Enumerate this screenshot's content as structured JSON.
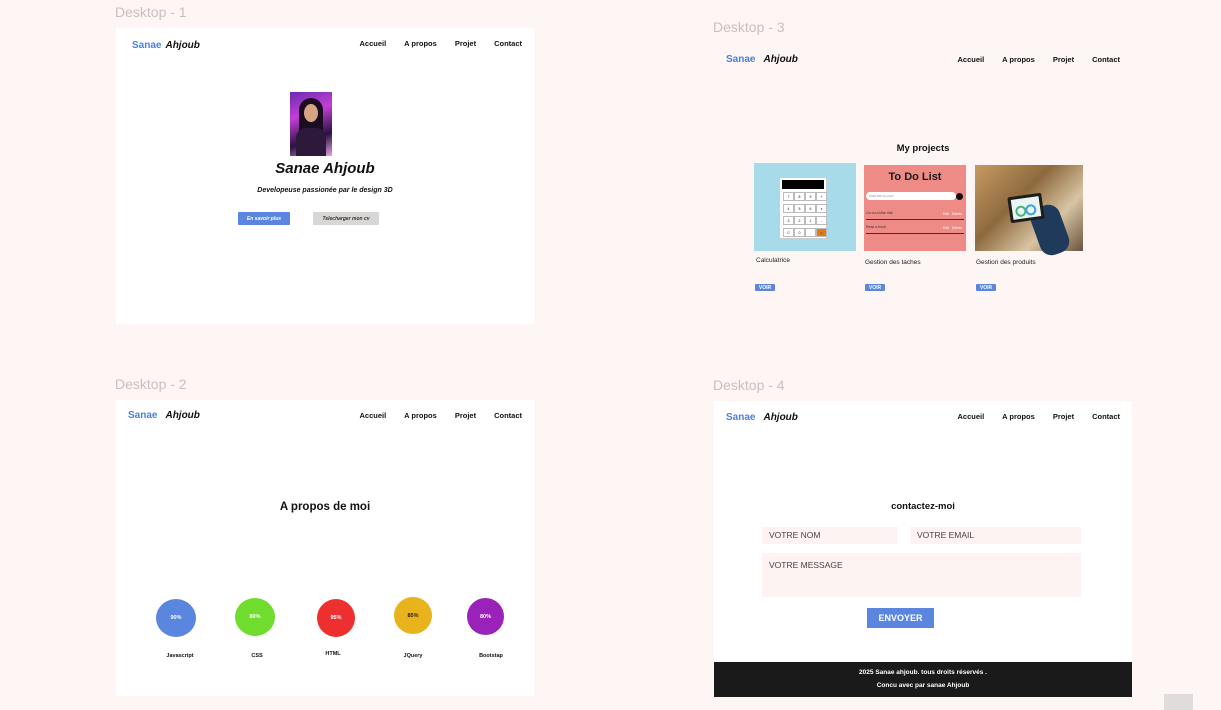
{
  "frames": {
    "f1": "Desktop - 1",
    "f2": "Desktop - 2",
    "f3": "Desktop - 3",
    "f4": "Desktop - 4"
  },
  "brand": {
    "first": "Sanae",
    "last": "Ahjoub"
  },
  "nav": [
    "Accueil",
    "A propos",
    "Projet",
    "Contact"
  ],
  "home": {
    "name": "Sanae Ahjoub",
    "tagline": "Developeuse passionée par le design 3D",
    "btn_more": "En savoir plus",
    "btn_cv": "Telecharger mon cv"
  },
  "projects": {
    "title": "My projects",
    "items": [
      {
        "caption": "Calculatrice",
        "button": "VOIR"
      },
      {
        "caption": "Gestion des taches",
        "button": "VOIR"
      },
      {
        "caption": "Gestion des produits",
        "button": "VOIR"
      }
    ],
    "todo": {
      "title": "To Do List",
      "placeholder": "What Will You Do?",
      "rows": [
        "Go on a bike ride",
        "Read a book"
      ],
      "edit": "Edit",
      "delete": "Delete"
    },
    "calc_keys": [
      "7",
      "8",
      "9",
      "+",
      "4",
      "5",
      "6",
      "x",
      "3",
      "2",
      "1",
      "-",
      "C",
      "0",
      ".",
      "="
    ]
  },
  "about": {
    "title": "A propos de moi",
    "skills": [
      {
        "name": "Javascript",
        "percent": "90%",
        "color": "#5b86e0"
      },
      {
        "name": "CSS",
        "percent": "80%",
        "color": "#6fdc2e"
      },
      {
        "name": "HTML",
        "percent": "95%",
        "color": "#ee2f2f"
      },
      {
        "name": "JQuery",
        "percent": "85%",
        "color": "#e8b31c"
      },
      {
        "name": "Bootstap",
        "percent": "80%",
        "color": "#9a22b8"
      }
    ]
  },
  "contact": {
    "title": "contactez-moi",
    "name_placeholder": "VOTRE NOM",
    "email_placeholder": "VOTRE EMAIL",
    "message_placeholder": "VOTRE MESSAGE",
    "send": "ENVOYER",
    "footer_line1": "2025 Sanae ahjoub. tous droits réservés .",
    "footer_line2": "Concu avec par sanae Ahjoub"
  }
}
